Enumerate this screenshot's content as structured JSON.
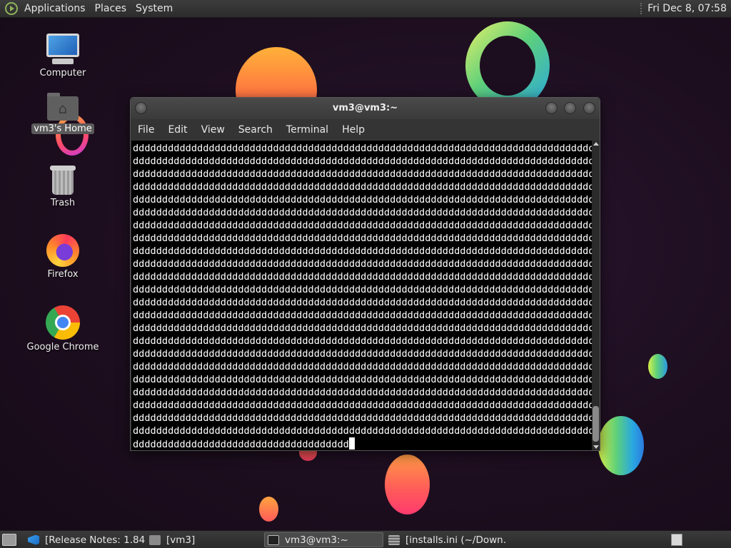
{
  "top_panel": {
    "menus": [
      "Applications",
      "Places",
      "System"
    ],
    "clock": "Fri Dec  8, 07:58"
  },
  "desktop": {
    "icons": [
      {
        "label": "Computer",
        "icon": "computer-icon"
      },
      {
        "label": "vm3's Home",
        "icon": "home-folder-icon",
        "selected": true
      },
      {
        "label": "Trash",
        "icon": "trash-icon"
      },
      {
        "label": "Firefox",
        "icon": "firefox-icon"
      },
      {
        "label": "Google Chrome",
        "icon": "chrome-icon"
      }
    ]
  },
  "terminal": {
    "title": "vm3@vm3:~",
    "menu": [
      "File",
      "Edit",
      "View",
      "Search",
      "Terminal",
      "Help"
    ],
    "lines": [
      "dddddddddddddddddddddddddddddddddddddddddddddddddddddddddddddddddddddddddddddddd",
      "dddddddddddddddddddddddddddddddddddddddddddddddddddddddddddddddddddddddddddddddd",
      "dddddddddddddddddddddddddddddddddddddddddddddddddddddddddddddddddddddddddddddddd",
      "dddddddddddddddddddddddddddddddddddddddddddddddddddddddddddddddddddddddddddddddd",
      "dddddddddddddddddddddddddddddddddddddddddddddddddddddddddddddddddddddddddddddddd",
      "dddddddddddddddddddddddddddddddddddddddddddddddddddddddddddddddddddddddddddddddd",
      "dddddddddddddddddddddddddddddddddddddddddddddddddddddddddddddddddddddddddddddddd",
      "dddddddddddddddddddddddddddddddddddddddddddddddddddddddddddddddddddddddddddddddd",
      "dddddddddddddddddddddddddddddddddddddddddddddddddddddddddddddddddddddddddddddddd",
      "dddddddddddddddddddddddddddddddddddddddddddddddddddddddddddddddddddddddddddddddd",
      "dddddddddddddddddddddddddddddddddddddddddddddddddddddddddddddddddddddddddddddddd",
      "dddddddddddddddddddddddddddddddddddddddddddddddddddddddddddddddddddddddddddddddd",
      "dddddddddddddddddddddddddddddddddddddddddddddddddddddddddddddddddddddddddddddddd",
      "dddddddddddddddddddddddddddddddddddddddddddddddddddddddddddddddddddddddddddddddd",
      "dddddddddddddddddddddddddddddddddddddddddddddddddddddddddddddddddddddddddddddddd",
      "dddddddddddddddddddddddddddddddddddddddddddddddddddddddddddddddddddddddddddddddd",
      "dddddddddddddddddddddddddddddddddddddddddddddddddddddddddddddddddddddddddddddddd",
      "dddddddddddddddddddddddddddddddddddddddddddddddddddddddddddddddddddddddddddddddd",
      "dddddddddddddddddddddddddddddddddddddddddddddddddddddddddddddddddddddddddddddddd",
      "dddddddddddddddddddddddddddddddddddddddddddddddddddddddddddddddddddddddddddddddd",
      "dddddddddddddddddddddddddddddddddddddddddddddddddddddddddddddddddddddddddddddddd",
      "dddddddddddddddddddddddddddddddddddddddddddddddddddddddddddddddddddddddddddddddd",
      "dddddddddddddddddddddddddddddddddddddddddddddddddddddddddddddddddddddddddddddddd",
      "ddddddddddddddddddddddddddddddddddddd"
    ]
  },
  "taskbar": {
    "tasks": [
      {
        "label": "[Release Notes: 1.84…",
        "icon": "vscode-icon",
        "active": false
      },
      {
        "label": "[vm3]",
        "icon": "folder-icon",
        "active": false
      },
      {
        "label": "vm3@vm3:~",
        "icon": "terminal-icon",
        "active": true
      },
      {
        "label": "[installs.ini (~/Down…",
        "icon": "text-editor-icon",
        "active": false
      }
    ]
  }
}
